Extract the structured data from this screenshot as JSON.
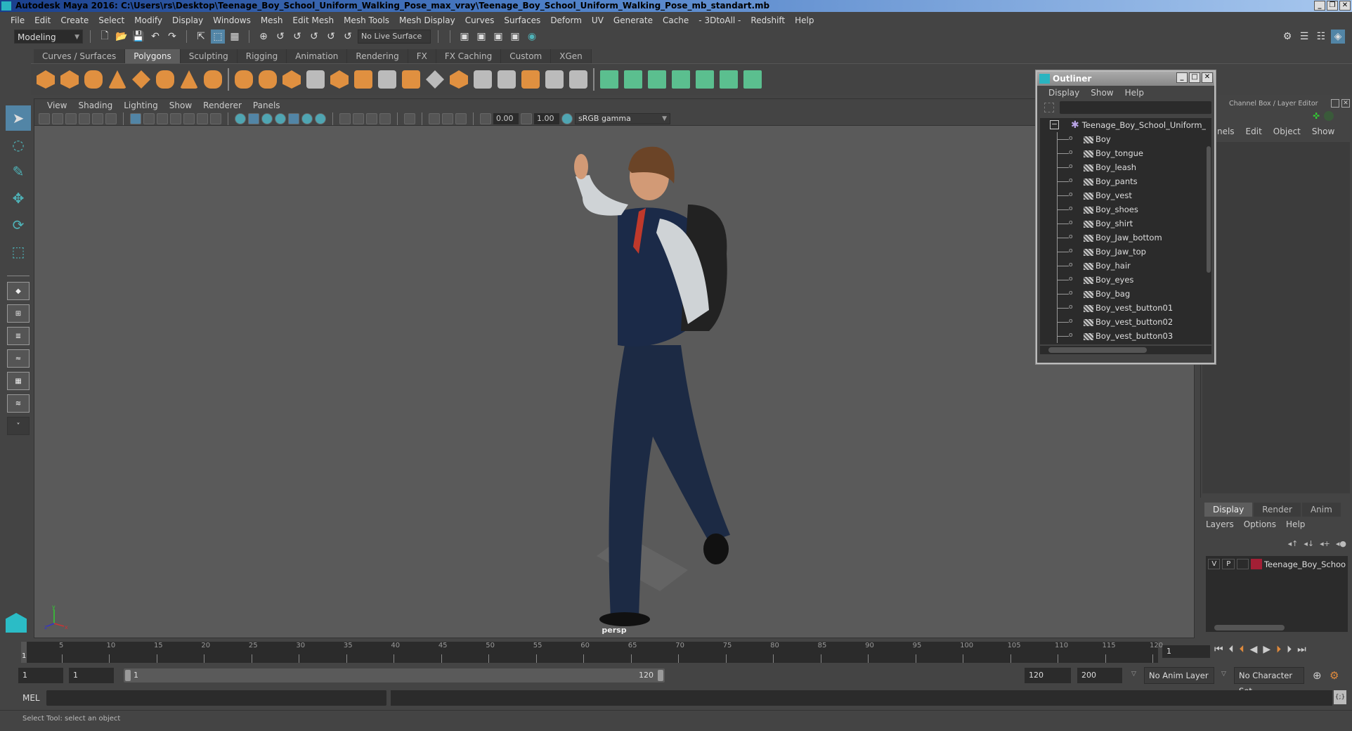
{
  "window": {
    "title": "Autodesk Maya 2016: C:\\Users\\rs\\Desktop\\Teenage_Boy_School_Uniform_Walking_Pose_max_vray\\Teenage_Boy_School_Uniform_Walking_Pose_mb_standart.mb",
    "controls": {
      "minimize": "_",
      "restore": "❐",
      "close": "✕"
    }
  },
  "menubar": [
    "File",
    "Edit",
    "Create",
    "Select",
    "Modify",
    "Display",
    "Windows",
    "Mesh",
    "Edit Mesh",
    "Mesh Tools",
    "Mesh Display",
    "Curves",
    "Surfaces",
    "Deform",
    "UV",
    "Generate",
    "Cache",
    "- 3DtoAll -",
    "Redshift",
    "Help"
  ],
  "statusline": {
    "mode": "Modeling",
    "live_surface": "No Live Surface"
  },
  "shelf": {
    "tabs": [
      "Curves / Surfaces",
      "Polygons",
      "Sculpting",
      "Rigging",
      "Animation",
      "Rendering",
      "FX",
      "FX Caching",
      "Custom",
      "XGen"
    ],
    "active_tab": "Polygons"
  },
  "viewport": {
    "menu": [
      "View",
      "Shading",
      "Lighting",
      "Show",
      "Renderer",
      "Panels"
    ],
    "exposure": "0.00",
    "gamma": "1.00",
    "color_space": "sRGB gamma",
    "camera_label": "persp",
    "axes": {
      "x": "x",
      "y": "y",
      "z": "z"
    }
  },
  "outliner": {
    "title": "Outliner",
    "menu": [
      "Display",
      "Show",
      "Help"
    ],
    "search_value": "",
    "root": "Teenage_Boy_School_Uniform_W",
    "items": [
      "Boy",
      "Boy_tongue",
      "Boy_leash",
      "Boy_pants",
      "Boy_vest",
      "Boy_shoes",
      "Boy_shirt",
      "Boy_Jaw_bottom",
      "Boy_Jaw_top",
      "Boy_hair",
      "Boy_eyes",
      "Boy_bag",
      "Boy_vest_button01",
      "Boy_vest_button02",
      "Boy_vest_button03"
    ]
  },
  "channel_box": {
    "title": "Channel Box / Layer Editor",
    "menu": [
      "annels",
      "Edit",
      "Object",
      "Show"
    ]
  },
  "layer_editor": {
    "tabs": [
      "Display",
      "Render",
      "Anim"
    ],
    "active_tab": "Display",
    "menu": [
      "Layers",
      "Options",
      "Help"
    ],
    "layers": [
      {
        "visible": "V",
        "playback": "P",
        "color": "#a31f35",
        "name": "Teenage_Boy_School_U"
      }
    ]
  },
  "timeline": {
    "ticks": [
      5,
      10,
      15,
      20,
      25,
      30,
      35,
      40,
      45,
      50,
      55,
      60,
      65,
      70,
      75,
      80,
      85,
      90,
      95,
      100,
      105,
      110,
      115,
      120
    ],
    "start": 1,
    "end": 120,
    "current_frame": "1",
    "current_marker": "1"
  },
  "range": {
    "start_field": "1",
    "playback_start": "1",
    "slider_start": "1",
    "slider_end": "120",
    "playback_end": "120",
    "end_field": "200",
    "anim_layer": "No Anim Layer",
    "character_set": "No Character Set"
  },
  "command_line": {
    "label": "MEL",
    "input_value": "",
    "result_value": ""
  },
  "status_bar": {
    "help_text": "Select Tool: select an object"
  }
}
